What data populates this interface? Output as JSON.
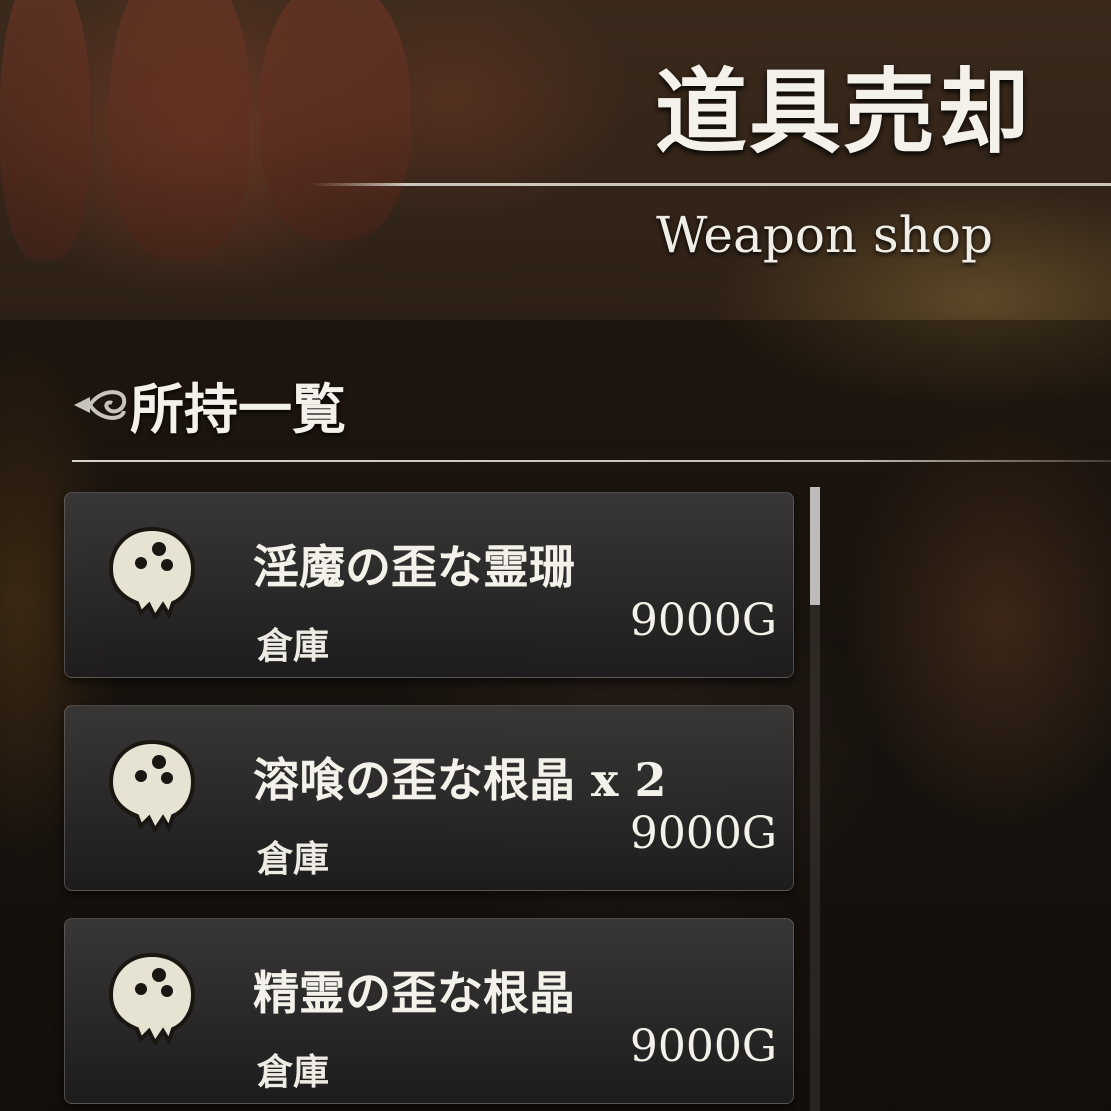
{
  "header": {
    "title": "道具売却",
    "subtitle": "Weapon shop"
  },
  "section": {
    "title": "所持一覧",
    "back_icon": "back-arrow-icon"
  },
  "items": [
    {
      "icon": "orb-icon",
      "name": "淫魔の歪な霊珊",
      "location": "倉庫",
      "price": "9000G"
    },
    {
      "icon": "orb-icon",
      "name": "溶喰の歪な根晶 x 2",
      "location": "倉庫",
      "price": "9000G"
    },
    {
      "icon": "orb-icon",
      "name": "精霊の歪な根晶",
      "location": "倉庫",
      "price": "9000G"
    }
  ],
  "colors": {
    "text": "#f4f1ea",
    "panel": "#2a2929",
    "accent": "#e0dcd2"
  }
}
